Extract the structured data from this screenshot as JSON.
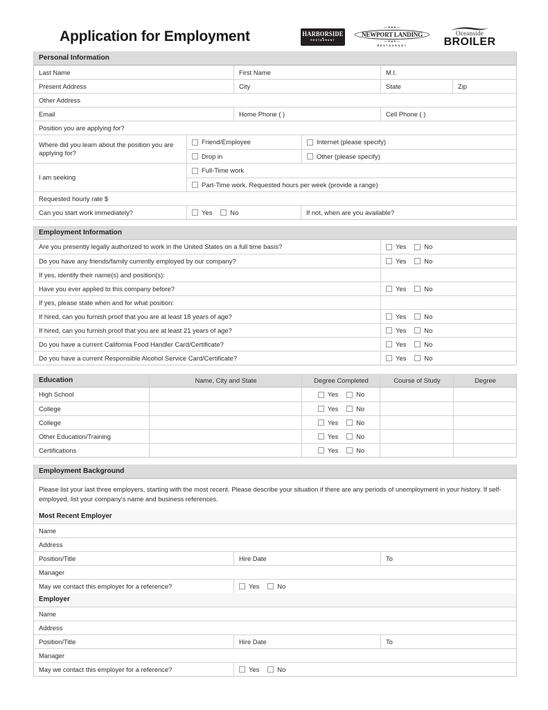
{
  "document": {
    "title": "Application for Employment"
  },
  "logos": [
    {
      "name": "harborside-logo",
      "main": "HARBORSIDE",
      "sub": "RESTAURANT"
    },
    {
      "name": "newport-landing-logo",
      "main": "NEWPORT LANDING",
      "sub": "RESTAURANT"
    },
    {
      "name": "oceanside-broiler-logo",
      "script": "Oceanside",
      "main": "BROILER"
    }
  ],
  "personal_information": {
    "heading": "Personal Information",
    "last_name": "Last Name",
    "first_name": "First Name",
    "middle_initial": "M.I.",
    "present_address": "Present Address",
    "city": "City",
    "state": "State",
    "zip": "Zip",
    "other_address": "Other Address",
    "email": "Email",
    "home_phone": "Home Phone (          )",
    "cell_phone": "Cell Phone (          )",
    "position_applying_for": "Position you are applying for?",
    "learn_about_label": "Where did you learn about the position you are applying for?",
    "learn_options": [
      "Friend/Employee",
      "Internet (please specify)",
      "Drop in",
      "Other (please specify)"
    ],
    "seeking_label": "I am seeking",
    "seeking_options": [
      "Full-Time work",
      "Part-Time work. Requested hours per week (provide a range)"
    ],
    "requested_rate": "Requested hourly rate  $",
    "start_immediately": "Can you start work immediately?",
    "yes": "Yes",
    "no": "No",
    "if_not_available": "If not, when are you available?"
  },
  "employment_information": {
    "heading": "Employment Information",
    "yes": "Yes",
    "no": "No",
    "rows": [
      {
        "question": "Are you presently legally authorized to work in the United States on a full time basis?",
        "has_yesno": true
      },
      {
        "question": "Do you have any friends/family currently employed by our company?",
        "has_yesno": true
      },
      {
        "question": "If yes, identify their name(s) and position(s):",
        "has_yesno": false
      },
      {
        "question": "Have you ever applied to this company before?",
        "has_yesno": true
      },
      {
        "question": "If yes, please state when and for what position:",
        "has_yesno": false
      },
      {
        "question": "If hired, can you furnish proof that you are at least 18 years of age?",
        "has_yesno": true
      },
      {
        "question": "If hired, can you furnish proof that you are at least 21 years of age?",
        "has_yesno": true
      },
      {
        "question": "Do you have a current California Food Handler Card/Certificate?",
        "has_yesno": true
      },
      {
        "question": "Do you have a current Responsible Alcohol Service Card/Certificate?",
        "has_yesno": true
      }
    ]
  },
  "education": {
    "heading": "Education",
    "columns": [
      "Name, City and State",
      "Degree Completed",
      "Course of Study",
      "Degree"
    ],
    "yes": "Yes",
    "no": "No",
    "rows": [
      "High School",
      "College",
      "College",
      "Other Education/Training",
      "Certifications"
    ]
  },
  "employment_background": {
    "heading": "Employment Background",
    "note": "Please list your last three employers, starting with the most recent. Please describe your situation if there are any periods of unemployment in your history. If self-employed, list your company's name and business references.",
    "yes": "Yes",
    "no": "No",
    "employers": [
      {
        "heading": "Most Recent Employer",
        "name": "Name",
        "address": "Address",
        "position_title": "Position/Title",
        "hire_date": "Hire Date",
        "to": "To",
        "manager": "Manager",
        "contact_question": "May we contact this employer for a reference?"
      },
      {
        "heading": "Employer",
        "name": "Name",
        "address": "Address",
        "position_title": "Position/Title",
        "hire_date": "Hire Date",
        "to": "To",
        "manager": "Manager",
        "contact_question": "May we contact this employer for a reference?"
      }
    ]
  }
}
